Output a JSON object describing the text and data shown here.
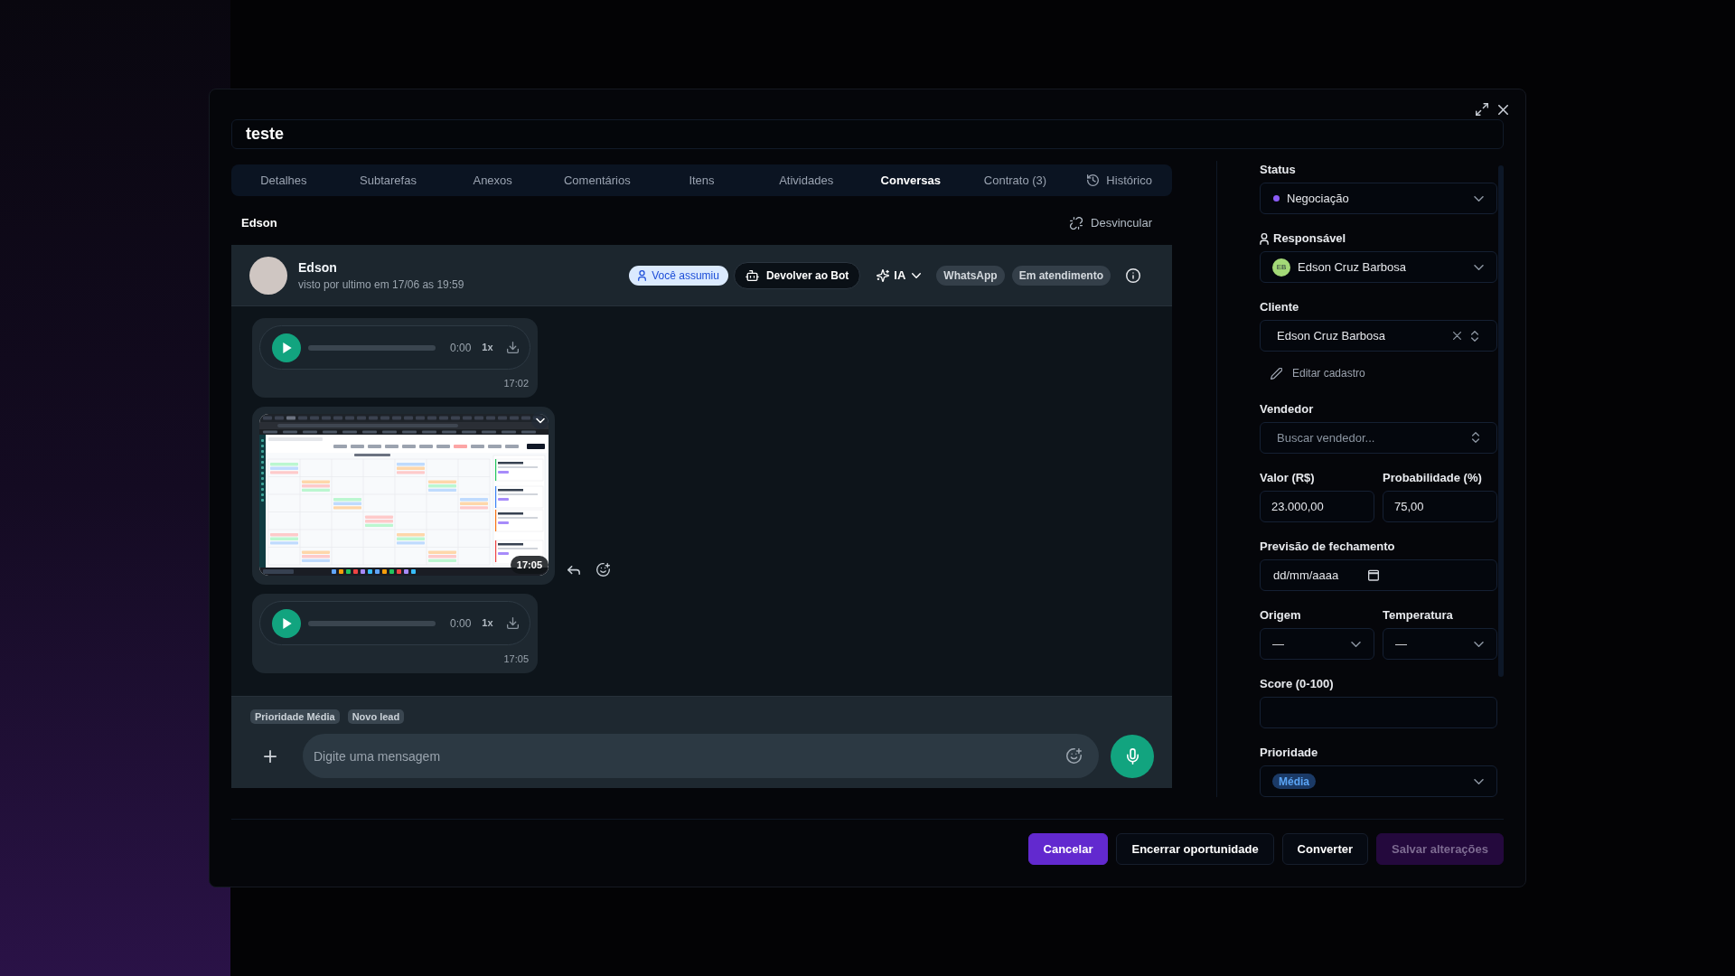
{
  "dialog": {
    "title": "teste"
  },
  "tabs": [
    {
      "label": "Detalhes",
      "selected": false,
      "kind": "text"
    },
    {
      "label": "Subtarefas",
      "selected": false,
      "kind": "text"
    },
    {
      "label": "Anexos",
      "selected": false,
      "kind": "text"
    },
    {
      "label": "Comentários",
      "selected": false,
      "kind": "text"
    },
    {
      "label": "Itens",
      "selected": false,
      "kind": "text"
    },
    {
      "label": "Atividades",
      "selected": false,
      "kind": "text"
    },
    {
      "label": "Conversas",
      "selected": true,
      "kind": "text"
    },
    {
      "label": "Contrato (3)",
      "selected": false,
      "kind": "text"
    },
    {
      "label": "Histórico",
      "selected": false,
      "kind": "icon"
    }
  ],
  "conversation": {
    "contact_label": "Edson",
    "unlink_button": "Desvincular",
    "header": {
      "name": "Edson",
      "last_seen": "visto por ultimo em 17/06 as 19:59",
      "assigned_badge": "Você assumiu",
      "return_button": "Devolver ao Bot",
      "ai_button": "IA",
      "channel_tag": "WhatsApp",
      "status_tag": "Em atendimento"
    },
    "messages": [
      {
        "kind": "audio",
        "level": 0,
        "duration": "0:00",
        "speed": "1x",
        "time": "17:02"
      },
      {
        "kind": "image",
        "time": "17:05"
      },
      {
        "kind": "audio",
        "level": 0,
        "duration": "0:00",
        "speed": "1x",
        "time": "17:05"
      }
    ],
    "tags": [
      "Prioridade Média",
      "Novo lead"
    ],
    "composer": {
      "placeholder": "Digite uma mensagem"
    }
  },
  "details": {
    "status": {
      "label": "Status",
      "value": "Negociação",
      "color": "#8b5cf6"
    },
    "responsible": {
      "label": "Responsável",
      "initials": "EB",
      "value": "Edson Cruz Barbosa"
    },
    "client": {
      "label": "Cliente",
      "value": "Edson Cruz Barbosa",
      "edit_link": "Editar cadastro"
    },
    "seller": {
      "label": "Vendedor",
      "placeholder": "Buscar vendedor..."
    },
    "amount": {
      "label": "Valor (R$)",
      "value": "23.000,00"
    },
    "probability": {
      "label": "Probabilidade (%)",
      "value": "75,00"
    },
    "close_date": {
      "label": "Previsão de fechamento",
      "placeholder": "dd/mm/aaaa"
    },
    "origin": {
      "label": "Origem",
      "value": "—"
    },
    "temperature": {
      "label": "Temperatura",
      "value": "—"
    },
    "score": {
      "label": "Score (0-100)"
    },
    "priority": {
      "label": "Prioridade",
      "value": "Média"
    }
  },
  "footer": {
    "buttons": [
      {
        "label": "Cancelar",
        "kind": "primary",
        "disabled": false
      },
      {
        "label": "Encerrar oportunidade",
        "kind": "outline",
        "disabled": false
      },
      {
        "label": "Converter",
        "kind": "outline",
        "disabled": false
      },
      {
        "label": "Salvar alterações",
        "kind": "primary",
        "disabled": true
      }
    ]
  }
}
